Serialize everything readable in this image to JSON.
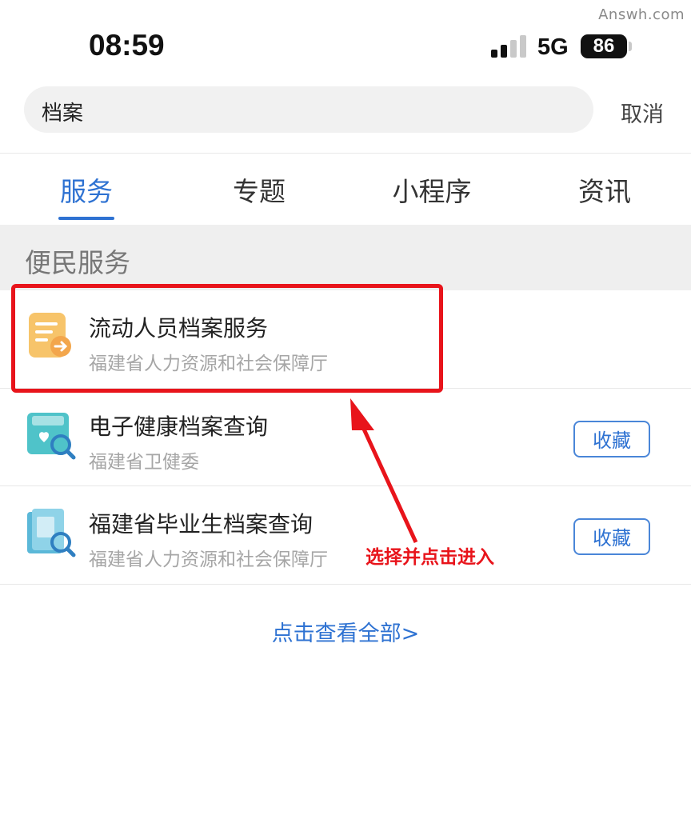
{
  "watermark": "Answh.com",
  "status_bar": {
    "time": "08:59",
    "network": "5G",
    "battery": "86",
    "icons": [
      "signal-icon",
      "battery-icon"
    ]
  },
  "search": {
    "value": "档案",
    "cancel_label": "取消"
  },
  "tabs": [
    {
      "label": "服务",
      "active": true
    },
    {
      "label": "专题",
      "active": false
    },
    {
      "label": "小程序",
      "active": false
    },
    {
      "label": "资讯",
      "active": false
    }
  ],
  "section": {
    "title": "便民服务"
  },
  "items": [
    {
      "title": "流动人员档案服务",
      "subtitle": "福建省人力资源和社会保障厅",
      "icon": "document-transfer-icon",
      "favorite_label": ""
    },
    {
      "title": "电子健康档案查询",
      "subtitle": "福建省卫健委",
      "icon": "health-record-search-icon",
      "favorite_label": "收藏"
    },
    {
      "title": "福建省毕业生档案查询",
      "subtitle": "福建省人力资源和社会保障厅",
      "icon": "archive-search-icon",
      "favorite_label": "收藏"
    }
  ],
  "annotation": "选择并点击进入",
  "view_all": "点击查看全部>",
  "colors": {
    "accent": "#2e72d2",
    "annotation_red": "#e8141b",
    "section_bg": "#efefef"
  }
}
